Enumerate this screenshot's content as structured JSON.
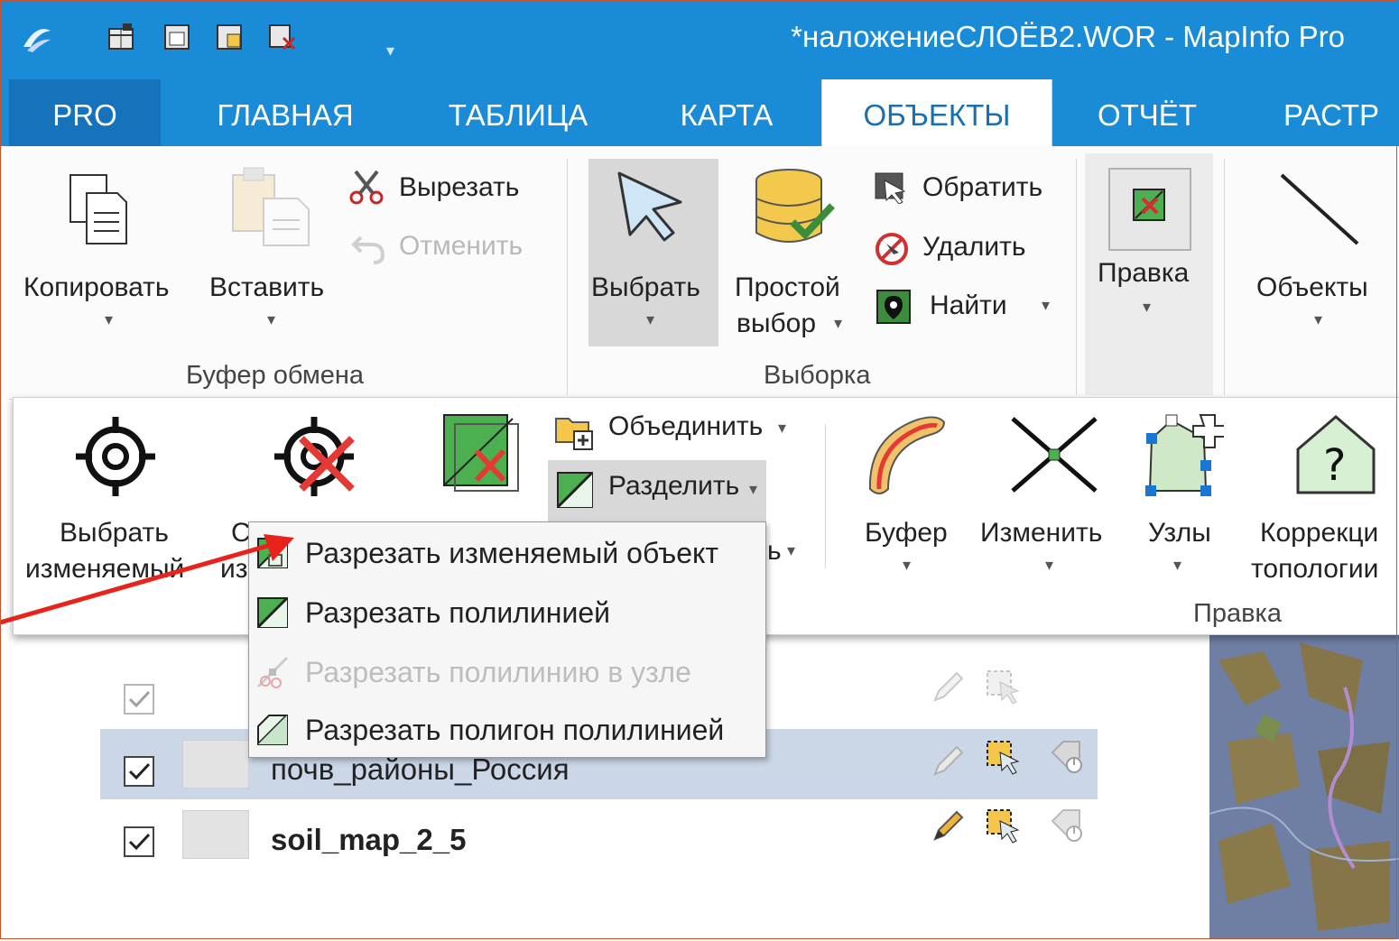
{
  "window": {
    "title": "*наложениеСЛОЁВ2.WOR - MapInfo Pro"
  },
  "tabs": [
    {
      "label": "PRO"
    },
    {
      "label": "ГЛАВНАЯ"
    },
    {
      "label": "ТАБЛИЦА"
    },
    {
      "label": "КАРТА"
    },
    {
      "label": "ОБЪЕКТЫ"
    },
    {
      "label": "ОТЧЁТ"
    },
    {
      "label": "РАСТР"
    }
  ],
  "clipboard": {
    "copy": "Копировать",
    "paste": "Вставить",
    "cut": "Вырезать",
    "undo": "Отменить",
    "group": "Буфер обмена"
  },
  "selection": {
    "select": "Выбрать",
    "simple_line1": "Простой",
    "simple_line2": "выбор",
    "invert": "Обратить",
    "delete": "Удалить",
    "find": "Найти",
    "group": "Выборка"
  },
  "edit": {
    "label": "Правка"
  },
  "objects": {
    "label": "Объекты"
  },
  "row2": {
    "select_editable_1": "Выбрать",
    "select_editable_2": "изменяемый",
    "clear_editable_1": "С",
    "clear_editable_2": "из",
    "fragment_3": "ь",
    "combine": "Объединить",
    "split": "Разделить",
    "buffer": "Буфер",
    "modify": "Изменить",
    "nodes": "Узлы",
    "topology_1": "Коррекци",
    "topology_2": "топологии",
    "group": "Правка"
  },
  "split_menu": {
    "items": [
      {
        "label": "Разрезать изменяемый объект",
        "enabled": true
      },
      {
        "label": "Разрезать полилинией",
        "enabled": true
      },
      {
        "label": "Разрезать полилинию в узле",
        "enabled": false
      },
      {
        "label": "Разрезать полигон полилинией",
        "enabled": true
      }
    ]
  },
  "layers": [
    {
      "name": "",
      "checked": true,
      "disabled": true
    },
    {
      "name": "почв_районы_Россия",
      "checked": true,
      "selected": true
    },
    {
      "name": "soil_map_2_5",
      "checked": true,
      "bold": true
    }
  ],
  "colors": {
    "titlebar": "#1a8bd6",
    "pro_tab": "#1672ba",
    "arrow": "#e8231b",
    "map": "#6f7fa4",
    "selected_row": "#cbd6e6"
  }
}
